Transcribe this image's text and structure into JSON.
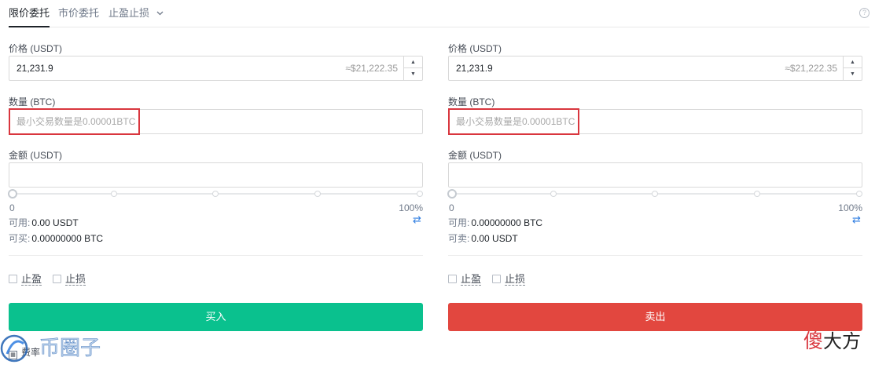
{
  "tabs": {
    "limit": "限价委托",
    "market": "市价委托",
    "stop": "止盈止损",
    "help": "?"
  },
  "buy": {
    "price_label": "价格 (USDT)",
    "price_value": "21,231.9",
    "price_approx": "≈$21,222.35",
    "amount_label": "数量 (BTC)",
    "amount_placeholder": "最小交易数量是0.00001BTC",
    "total_label": "金额 (USDT)",
    "slider_min": "0",
    "slider_max": "100%",
    "slider_percent": 0,
    "available_label": "可用:",
    "available_value": "0.00 USDT",
    "can_trade_label": "可买:",
    "can_trade_value": "0.00000000 BTC",
    "take_profit": "止盈",
    "stop_loss": "止损",
    "action": "买入"
  },
  "sell": {
    "price_label": "价格 (USDT)",
    "price_value": "21,231.9",
    "price_approx": "≈$21,222.35",
    "amount_label": "数量 (BTC)",
    "amount_placeholder": "最小交易数量是0.00001BTC",
    "total_label": "金额 (USDT)",
    "slider_min": "0",
    "slider_max": "100%",
    "slider_percent": 0,
    "available_label": "可用:",
    "available_value": "0.00000000 BTC",
    "can_trade_label": "可卖:",
    "can_trade_value": "0.00 USDT",
    "take_profit": "止盈",
    "stop_loss": "止损",
    "action": "卖出"
  },
  "footer": {
    "fee": "费率"
  },
  "watermarks": {
    "left": "币圈子",
    "right_a": "傻",
    "right_b": "大方"
  },
  "colors": {
    "buy": "#0ac18e",
    "sell": "#e2473f",
    "highlight": "#d9363e",
    "swap": "#2e7de1"
  }
}
